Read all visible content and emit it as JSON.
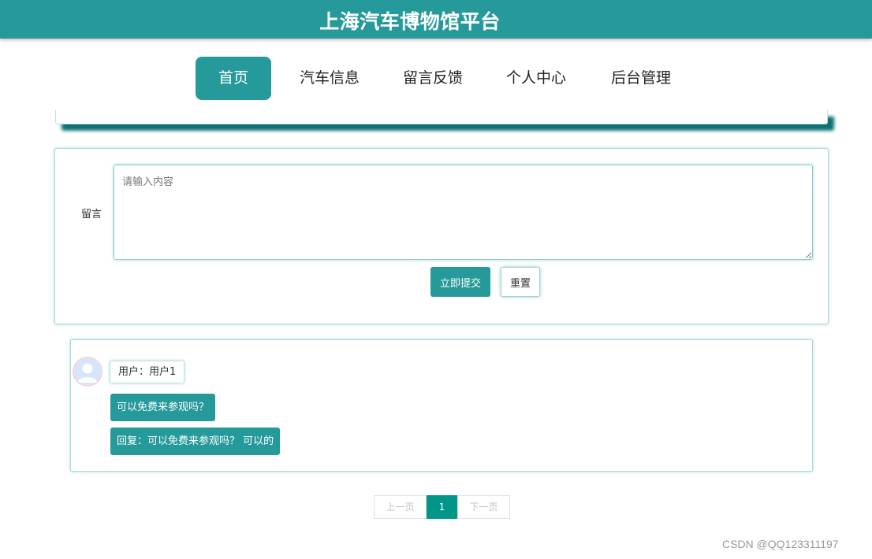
{
  "site": {
    "title": "上海汽车博物馆平台"
  },
  "nav": {
    "items": [
      {
        "label": "首页",
        "active": true
      },
      {
        "label": "汽车信息",
        "active": false
      },
      {
        "label": "留言反馈",
        "active": false
      },
      {
        "label": "个人中心",
        "active": false
      },
      {
        "label": "后台管理",
        "active": false
      }
    ]
  },
  "form": {
    "label": "留言",
    "placeholder": "请输入内容",
    "value": "",
    "submit_label": "立即提交",
    "reset_label": "重置"
  },
  "comments": [
    {
      "avatar_icon": "user-avatar-icon",
      "user_label": "用户：用户1",
      "message": "可以免费来参观吗？",
      "reply": "回复：可以免费来参观吗？ 可以的"
    }
  ],
  "pagination": {
    "prev_label": "上一页",
    "current_page": "1",
    "next_label": "下一页"
  },
  "watermark": "CSDN @QQ123311197",
  "colors": {
    "primary": "#269a9a",
    "page_active": "#009688"
  }
}
